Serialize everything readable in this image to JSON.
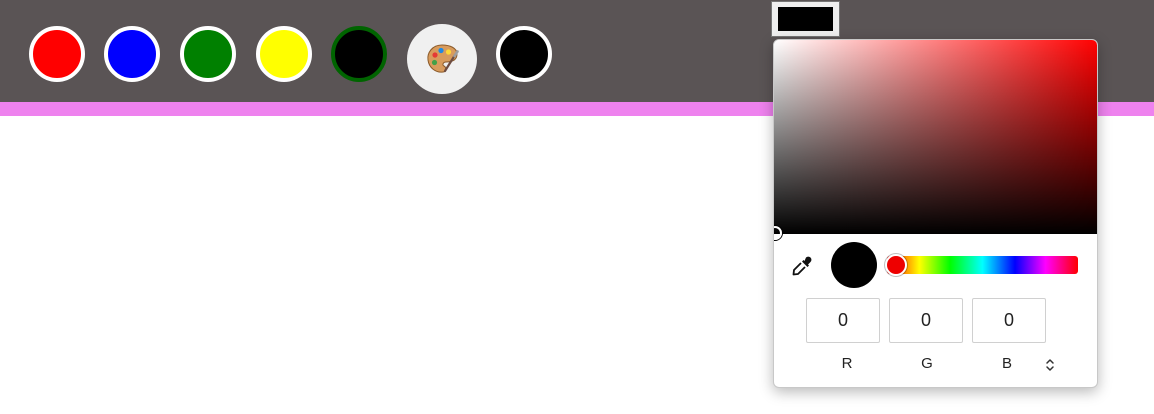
{
  "toolbar": {
    "swatches": [
      {
        "name": "red",
        "color": "#ff0000",
        "selected": false
      },
      {
        "name": "blue",
        "color": "#0000ff",
        "selected": false
      },
      {
        "name": "green",
        "color": "#008000",
        "selected": false
      },
      {
        "name": "yellow",
        "color": "#ffff00",
        "selected": false
      },
      {
        "name": "black",
        "color": "#000000",
        "selected": true
      },
      {
        "name": "custom",
        "color": "#000000",
        "selected": false
      }
    ],
    "palette_icon": "artist-palette-icon",
    "background_color": "#5a5455",
    "accent_color": "#ee82ee"
  },
  "color_input": {
    "value": "#000000"
  },
  "color_picker": {
    "hue_color": "#ff0000",
    "current_color": "#000000",
    "eyedropper_icon": "eyedropper-icon",
    "inputs": [
      {
        "label": "R",
        "value": "0"
      },
      {
        "label": "G",
        "value": "0"
      },
      {
        "label": "B",
        "value": "0"
      }
    ],
    "format_toggle_icon": "chevron-up-down-icon"
  }
}
